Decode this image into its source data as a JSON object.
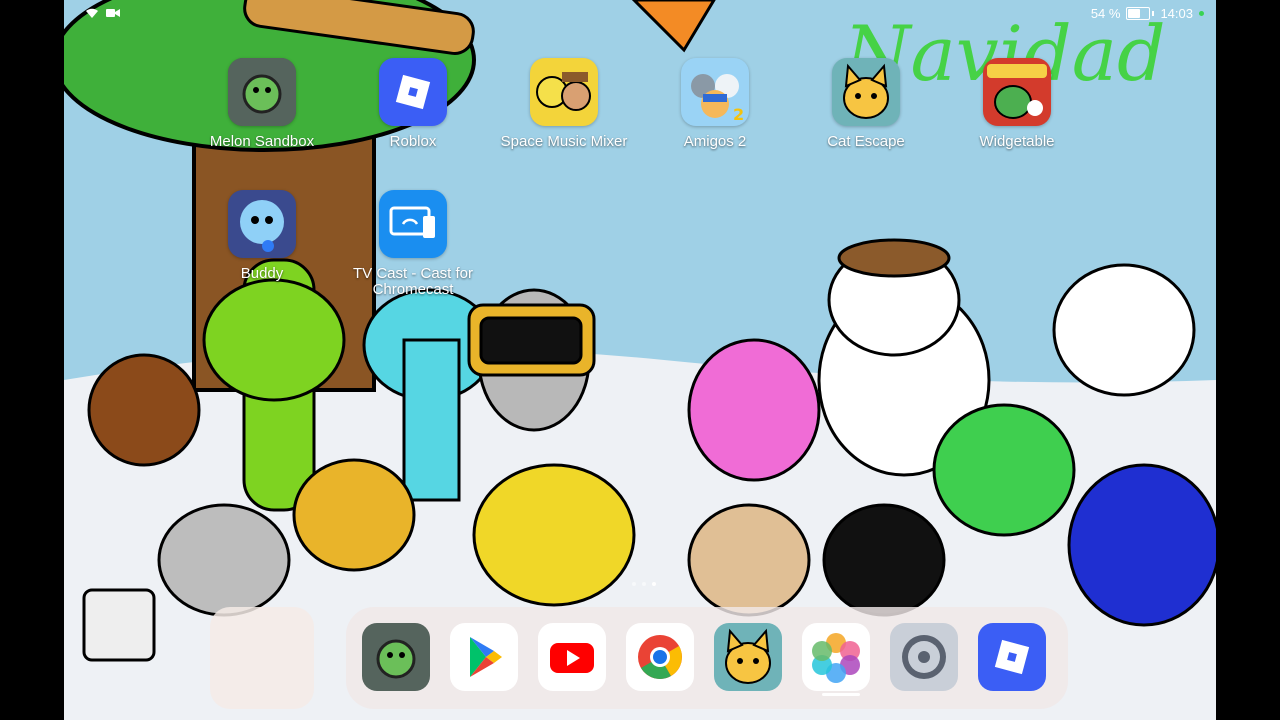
{
  "status_bar": {
    "battery_percent": "54 %",
    "battery_level": 0.54,
    "time": "14:03",
    "icons": [
      "wifi-icon",
      "camera-record-icon",
      "battery-icon"
    ]
  },
  "wallpaper": {
    "text": "Navidad",
    "description_icons": [
      "tree",
      "snowman",
      "characters"
    ]
  },
  "home_apps": [
    {
      "label": "Melon Sandbox",
      "icon": "melon-sandbox-icon"
    },
    {
      "label": "Roblox",
      "icon": "roblox-icon"
    },
    {
      "label": "Space Music Mixer",
      "icon": "space-music-mixer-icon"
    },
    {
      "label": "Amigos 2",
      "icon": "amigos-2-icon"
    },
    {
      "label": "Cat Escape",
      "icon": "cat-escape-icon"
    },
    {
      "label": "Widgetable",
      "icon": "widgetable-icon"
    },
    {
      "label": "Buddy",
      "icon": "buddy-icon"
    },
    {
      "label": "TV Cast - Cast for Chromecast",
      "icon": "tv-cast-icon"
    }
  ],
  "dock_apps": [
    {
      "name": "Melon Sandbox",
      "icon": "melon-sandbox-icon"
    },
    {
      "name": "Google Play",
      "icon": "play-store-icon"
    },
    {
      "name": "YouTube",
      "icon": "youtube-icon"
    },
    {
      "name": "Chrome",
      "icon": "chrome-icon"
    },
    {
      "name": "Cat Escape",
      "icon": "cat-escape-icon"
    },
    {
      "name": "Gallery",
      "icon": "gallery-icon"
    },
    {
      "name": "Settings",
      "icon": "settings-icon"
    },
    {
      "name": "Roblox",
      "icon": "roblox-icon"
    }
  ],
  "page_indicator": {
    "count": 3,
    "active": 2
  },
  "colors": {
    "sky": "#9fd0e6",
    "snow": "#f3f5f8",
    "roblox": "#3b5ef5",
    "youtube": "#ff0000"
  }
}
